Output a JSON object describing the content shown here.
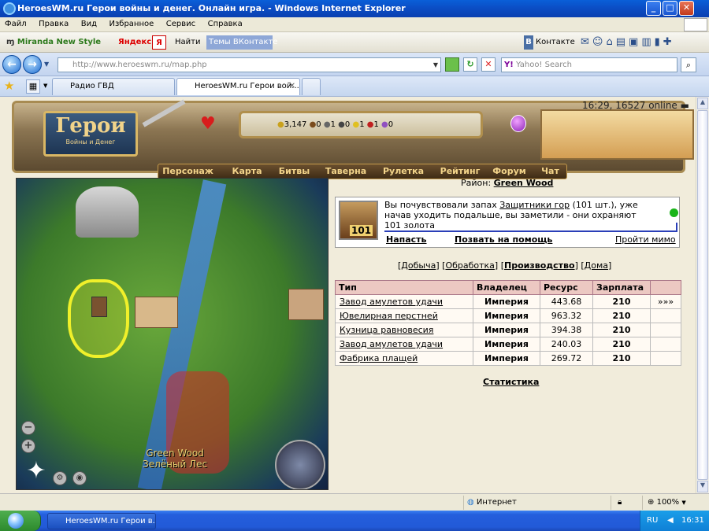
{
  "window": {
    "title": "HeroesWM.ru Герои войны и денег. Онлайн игра. - Windows Internet Explorer",
    "buttons": [
      "_",
      "□",
      "✕"
    ]
  },
  "menu": [
    "Файл",
    "Правка",
    "Вид",
    "Избранное",
    "Сервис",
    "Справка"
  ],
  "toolbar1": {
    "miranda": "Miranda New Style",
    "yandex": "Яндекс",
    "ya_btn": "Я",
    "find": "Найти",
    "vk_themes": "Темы ВКонтакте",
    "vk": "Контакте",
    "vk_letter": "В"
  },
  "address": {
    "url": "http://www.heroeswm.ru/map.php",
    "search_placeholder": "Yahoo! Search"
  },
  "tabs": [
    {
      "label": "Радио ГВД"
    },
    {
      "label": "HeroesWM.ru Герои вой..."
    }
  ],
  "game": {
    "online": "16:29, 16527 online",
    "logo_title": "Герои",
    "logo_sub": "Войны и Денег",
    "resources": [
      "3,147",
      "0",
      "1",
      "0",
      "1",
      "1",
      "0"
    ],
    "nav": [
      "Персонаж",
      "Карта",
      "Битвы",
      "Таверна",
      "Рулетка",
      "Рейтинг",
      "Форум",
      "Чат"
    ]
  },
  "map": {
    "label_en": "Green Wood",
    "label_ru": "Зелёный Лес",
    "zoom_out": "−",
    "zoom_in": "+"
  },
  "district": {
    "prefix": "Район:",
    "name": "Green Wood"
  },
  "event": {
    "count": "101",
    "text1": "Вы почувствовали запах ",
    "text_link": "Защитники гор",
    "text2": " (101 шт.), уже начав уходить подальше, вы заметили - они охраняют 101 золота",
    "attack": "Напасть",
    "help": "Позвать на помощь",
    "pass": "Пройти мимо"
  },
  "subtabs": [
    "Добыча",
    "Обработка",
    "Производство",
    "Дома"
  ],
  "table": {
    "headers": [
      "Тип",
      "Владелец",
      "Ресурс",
      "Зарплата",
      ""
    ],
    "rows": [
      {
        "type": "Завод амулетов удачи",
        "owner": "Империя",
        "resource": "443.68",
        "salary": "210",
        "more": "»»»"
      },
      {
        "type": "Ювелирная перстней",
        "owner": "Империя",
        "resource": "963.32",
        "salary": "210",
        "more": ""
      },
      {
        "type": "Кузница равновесия",
        "owner": "Империя",
        "resource": "394.38",
        "salary": "210",
        "more": ""
      },
      {
        "type": "Завод амулетов удачи",
        "owner": "Империя",
        "resource": "240.03",
        "salary": "210",
        "more": ""
      },
      {
        "type": "Фабрика плащей",
        "owner": "Империя",
        "resource": "269.72",
        "salary": "210",
        "more": ""
      }
    ]
  },
  "stats_link": "Статистика",
  "statusbar": {
    "zone": "Интернет",
    "zoom": "100%"
  },
  "taskbar": {
    "task": "HeroesWM.ru Герои в...",
    "lang": "RU",
    "time": "16:31"
  }
}
